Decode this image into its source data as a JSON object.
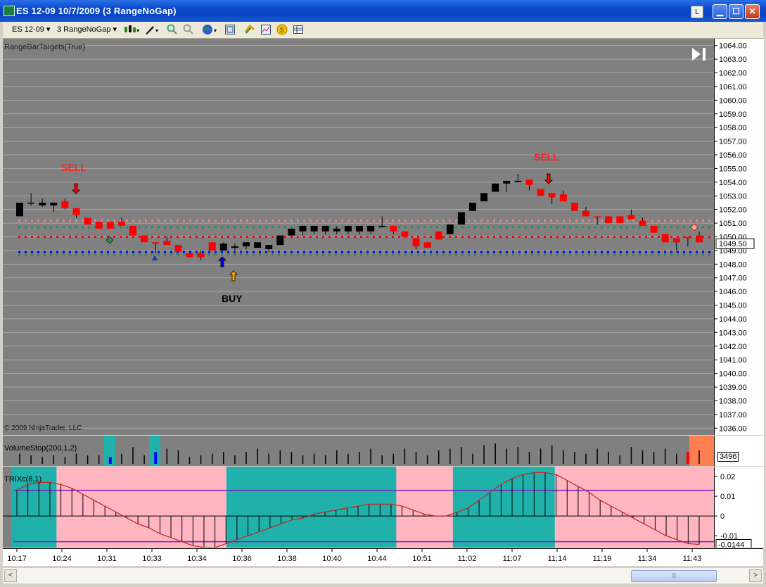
{
  "window": {
    "title": "ES 12-09  10/7/2009 (3 RangeNoGap)",
    "link_button": "L"
  },
  "toolbar": {
    "instrument": "ES 12-09",
    "period": "3 RangeNoGap"
  },
  "panels": {
    "price_label": "RangeBarTargets(True)",
    "copyright": "© 2009 NinjaTrader, LLC",
    "volume_label": "VolumeStop(200,1,2)",
    "trix_label": "TRIXc(8,1)"
  },
  "signals": {
    "sell_1": "SELL",
    "sell_2": "SELL",
    "buy_1": "BUY"
  },
  "axis": {
    "price_ticks": [
      "1064.00",
      "1063.00",
      "1062.00",
      "1061.00",
      "1060.00",
      "1059.00",
      "1058.00",
      "1057.00",
      "1056.00",
      "1055.00",
      "1054.00",
      "1053.00",
      "1052.00",
      "1051.00",
      "1050.00",
      "1049.00",
      "1048.00",
      "1047.00",
      "1046.00",
      "1045.00",
      "1044.00",
      "1043.00",
      "1042.00",
      "1041.00",
      "1040.00",
      "1039.00",
      "1038.00",
      "1037.00",
      "1036.00"
    ],
    "last_price": "1049.50",
    "volume_value": "3496",
    "trix_ticks": [
      "0.02",
      "0.01",
      "0",
      "-0.01"
    ],
    "trix_value": "-0.0144",
    "time_ticks": [
      "10:17",
      "10:24",
      "10:31",
      "10:33",
      "10:34",
      "10:36",
      "10:38",
      "10:40",
      "10:44",
      "10:51",
      "11:02",
      "11:07",
      "11:14",
      "11:19",
      "11:34",
      "11:43"
    ]
  },
  "scrollbar": {
    "left_arrow": "<",
    "right_arrow": ">",
    "thumb_grip": "|||"
  },
  "colors": {
    "panel_bg": "#808080",
    "up_bar": "#000000",
    "down_bar": "#ff0000",
    "trix_up_zone": "#20b2aa",
    "trix_down_zone": "#ffb6c1",
    "target_red": "#ff0000",
    "target_pink": "#ff8080",
    "target_green": "#2e8b57",
    "target_blue": "#0000ff"
  },
  "chart_data": {
    "type": "candlestick",
    "price_range": [
      1035.5,
      1064.5
    ],
    "candles": [
      {
        "o": 1051.5,
        "c": 1052.5,
        "h": 1052.5,
        "l": 1051.5,
        "dir": "up"
      },
      {
        "o": 1052.5,
        "c": 1052.5,
        "h": 1053.2,
        "l": 1052.3,
        "dir": "up"
      },
      {
        "o": 1052.5,
        "c": 1052.3,
        "h": 1052.8,
        "l": 1052.2,
        "dir": "up"
      },
      {
        "o": 1052.5,
        "c": 1052.3,
        "h": 1052.5,
        "l": 1051.8,
        "dir": "up"
      },
      {
        "o": 1052.6,
        "c": 1052.1,
        "h": 1052.8,
        "l": 1052.0,
        "dir": "down"
      },
      {
        "o": 1052.1,
        "c": 1051.6,
        "h": 1052.1,
        "l": 1051.4,
        "dir": "down"
      },
      {
        "o": 1051.4,
        "c": 1050.9,
        "h": 1051.4,
        "l": 1050.9,
        "dir": "down"
      },
      {
        "o": 1051.1,
        "c": 1050.6,
        "h": 1051.1,
        "l": 1050.6,
        "dir": "down"
      },
      {
        "o": 1051.1,
        "c": 1050.6,
        "h": 1051.1,
        "l": 1050.6,
        "dir": "down"
      },
      {
        "o": 1051.1,
        "c": 1050.8,
        "h": 1051.4,
        "l": 1050.8,
        "dir": "down"
      },
      {
        "o": 1050.8,
        "c": 1050.1,
        "h": 1050.8,
        "l": 1050.1,
        "dir": "down"
      },
      {
        "o": 1050.1,
        "c": 1049.6,
        "h": 1050.1,
        "l": 1049.6,
        "dir": "down"
      },
      {
        "o": 1049.6,
        "c": 1049.5,
        "h": 1049.6,
        "l": 1048.8,
        "dir": "down"
      },
      {
        "o": 1049.7,
        "c": 1049.4,
        "h": 1050.0,
        "l": 1049.4,
        "dir": "down"
      },
      {
        "o": 1049.4,
        "c": 1048.9,
        "h": 1049.4,
        "l": 1048.9,
        "dir": "down"
      },
      {
        "o": 1048.8,
        "c": 1048.5,
        "h": 1048.8,
        "l": 1048.5,
        "dir": "down"
      },
      {
        "o": 1048.8,
        "c": 1048.5,
        "h": 1049.0,
        "l": 1048.3,
        "dir": "down"
      },
      {
        "o": 1049.6,
        "c": 1049.0,
        "h": 1049.6,
        "l": 1049.0,
        "dir": "down"
      },
      {
        "o": 1049.0,
        "c": 1049.5,
        "h": 1049.6,
        "l": 1049.0,
        "dir": "up"
      },
      {
        "o": 1049.2,
        "c": 1049.3,
        "h": 1049.5,
        "l": 1049.0,
        "dir": "up"
      },
      {
        "o": 1049.3,
        "c": 1049.6,
        "h": 1049.6,
        "l": 1049.1,
        "dir": "up"
      },
      {
        "o": 1049.2,
        "c": 1049.6,
        "h": 1049.6,
        "l": 1049.2,
        "dir": "up"
      },
      {
        "o": 1049.1,
        "c": 1049.4,
        "h": 1049.4,
        "l": 1048.9,
        "dir": "up"
      },
      {
        "o": 1049.4,
        "c": 1050.1,
        "h": 1050.1,
        "l": 1049.4,
        "dir": "up"
      },
      {
        "o": 1050.1,
        "c": 1050.6,
        "h": 1050.6,
        "l": 1050.1,
        "dir": "up"
      },
      {
        "o": 1050.4,
        "c": 1050.8,
        "h": 1050.8,
        "l": 1050.1,
        "dir": "up"
      },
      {
        "o": 1050.4,
        "c": 1050.8,
        "h": 1050.8,
        "l": 1050.2,
        "dir": "up"
      },
      {
        "o": 1050.4,
        "c": 1050.8,
        "h": 1050.8,
        "l": 1050.2,
        "dir": "up"
      },
      {
        "o": 1050.4,
        "c": 1050.6,
        "h": 1050.8,
        "l": 1050.2,
        "dir": "up"
      },
      {
        "o": 1050.4,
        "c": 1050.8,
        "h": 1050.8,
        "l": 1050.2,
        "dir": "up"
      },
      {
        "o": 1050.4,
        "c": 1050.8,
        "h": 1050.8,
        "l": 1050.2,
        "dir": "up"
      },
      {
        "o": 1050.4,
        "c": 1050.8,
        "h": 1050.8,
        "l": 1050.2,
        "dir": "up"
      },
      {
        "o": 1050.8,
        "c": 1050.8,
        "h": 1051.5,
        "l": 1050.7,
        "dir": "up"
      },
      {
        "o": 1050.8,
        "c": 1050.4,
        "h": 1050.8,
        "l": 1050.2,
        "dir": "down"
      },
      {
        "o": 1050.4,
        "c": 1050.0,
        "h": 1050.4,
        "l": 1050.0,
        "dir": "down"
      },
      {
        "o": 1049.9,
        "c": 1049.3,
        "h": 1049.9,
        "l": 1049.1,
        "dir": "down"
      },
      {
        "o": 1049.6,
        "c": 1049.2,
        "h": 1049.6,
        "l": 1049.2,
        "dir": "down"
      },
      {
        "o": 1050.4,
        "c": 1049.8,
        "h": 1050.4,
        "l": 1049.8,
        "dir": "down"
      },
      {
        "o": 1050.2,
        "c": 1050.9,
        "h": 1050.9,
        "l": 1050.2,
        "dir": "up"
      },
      {
        "o": 1050.9,
        "c": 1051.8,
        "h": 1051.8,
        "l": 1050.9,
        "dir": "up"
      },
      {
        "o": 1051.9,
        "c": 1052.5,
        "h": 1052.5,
        "l": 1051.9,
        "dir": "up"
      },
      {
        "o": 1052.6,
        "c": 1053.2,
        "h": 1053.2,
        "l": 1052.6,
        "dir": "up"
      },
      {
        "o": 1053.3,
        "c": 1053.9,
        "h": 1053.9,
        "l": 1053.3,
        "dir": "up"
      },
      {
        "o": 1053.9,
        "c": 1054.1,
        "h": 1054.1,
        "l": 1053.3,
        "dir": "up"
      },
      {
        "o": 1054.0,
        "c": 1054.1,
        "h": 1054.6,
        "l": 1054.0,
        "dir": "up"
      },
      {
        "o": 1054.2,
        "c": 1053.8,
        "h": 1054.2,
        "l": 1053.4,
        "dir": "down"
      },
      {
        "o": 1053.5,
        "c": 1053.0,
        "h": 1053.5,
        "l": 1053.0,
        "dir": "down"
      },
      {
        "o": 1053.2,
        "c": 1052.9,
        "h": 1053.2,
        "l": 1052.4,
        "dir": "down"
      },
      {
        "o": 1053.1,
        "c": 1052.6,
        "h": 1053.4,
        "l": 1052.6,
        "dir": "down"
      },
      {
        "o": 1052.5,
        "c": 1051.9,
        "h": 1052.5,
        "l": 1051.9,
        "dir": "down"
      },
      {
        "o": 1051.9,
        "c": 1051.5,
        "h": 1052.2,
        "l": 1051.5,
        "dir": "down"
      },
      {
        "o": 1051.5,
        "c": 1051.5,
        "h": 1051.5,
        "l": 1050.9,
        "dir": "down"
      },
      {
        "o": 1051.5,
        "c": 1051.0,
        "h": 1051.5,
        "l": 1051.0,
        "dir": "down"
      },
      {
        "o": 1051.5,
        "c": 1051.0,
        "h": 1051.5,
        "l": 1051.0,
        "dir": "down"
      },
      {
        "o": 1051.6,
        "c": 1051.3,
        "h": 1052.0,
        "l": 1051.3,
        "dir": "down"
      },
      {
        "o": 1051.2,
        "c": 1050.8,
        "h": 1051.4,
        "l": 1050.8,
        "dir": "down"
      },
      {
        "o": 1050.8,
        "c": 1050.3,
        "h": 1050.8,
        "l": 1050.3,
        "dir": "down"
      },
      {
        "o": 1050.2,
        "c": 1049.6,
        "h": 1050.2,
        "l": 1049.6,
        "dir": "down"
      },
      {
        "o": 1049.9,
        "c": 1049.6,
        "h": 1049.9,
        "l": 1049.0,
        "dir": "down"
      },
      {
        "o": 1050.0,
        "c": 1049.9,
        "h": 1050.0,
        "l": 1049.3,
        "dir": "down"
      },
      {
        "o": 1050.1,
        "c": 1049.6,
        "h": 1050.4,
        "l": 1049.6,
        "dir": "down"
      }
    ],
    "target_lines": [
      {
        "price": 1051.2,
        "color": "pink"
      },
      {
        "price": 1050.7,
        "color": "green"
      },
      {
        "price": 1050.0,
        "color": "red"
      },
      {
        "price": 1048.9,
        "color": "blue"
      },
      {
        "price": 1048.7,
        "color": "green"
      }
    ],
    "volume": [
      6,
      5,
      4,
      5,
      4,
      6,
      5,
      5,
      4,
      6,
      10,
      5,
      7,
      9,
      8,
      4,
      5,
      6,
      7,
      5,
      7,
      9,
      6,
      8,
      7,
      5,
      6,
      5,
      8,
      6,
      7,
      9,
      5,
      6,
      9,
      7,
      5,
      8,
      9,
      10,
      6,
      11,
      12,
      9,
      10,
      7,
      9,
      11,
      8,
      7,
      6,
      9,
      7,
      5,
      10,
      8,
      7,
      9,
      6,
      7,
      8
    ],
    "trix": {
      "range": [
        -0.016,
        0.025
      ],
      "bands": [
        0.013,
        -0.013
      ],
      "values": [
        0.013,
        0.016,
        0.017,
        0.017,
        0.016,
        0.014,
        0.011,
        0.008,
        0.005,
        0.002,
        -0.001,
        -0.004,
        -0.006,
        -0.009,
        -0.011,
        -0.013,
        -0.015,
        -0.016,
        -0.016,
        -0.014,
        -0.012,
        -0.01,
        -0.008,
        -0.006,
        -0.004,
        -0.002,
        -0.001,
        0.001,
        0.002,
        0.003,
        0.004,
        0.005,
        0.006,
        0.006,
        0.006,
        0.005,
        0.003,
        0.001,
        0.0,
        0.0,
        0.002,
        0.004,
        0.008,
        0.012,
        0.016,
        0.019,
        0.021,
        0.022,
        0.022,
        0.021,
        0.018,
        0.015,
        0.012,
        0.008,
        0.005,
        0.002,
        -0.001,
        -0.004,
        -0.007,
        -0.01,
        -0.012,
        -0.014,
        -0.0144
      ],
      "zones": [
        "up",
        "up",
        "up",
        "up",
        "down",
        "down",
        "down",
        "down",
        "down",
        "down",
        "down",
        "down",
        "down",
        "down",
        "down",
        "down",
        "down",
        "down",
        "down",
        "up",
        "up",
        "up",
        "up",
        "up",
        "up",
        "up",
        "up",
        "up",
        "up",
        "up",
        "up",
        "up",
        "up",
        "up",
        "down",
        "down",
        "down",
        "down",
        "down",
        "up",
        "up",
        "up",
        "up",
        "up",
        "up",
        "up",
        "up",
        "up",
        "down",
        "down",
        "down",
        "down",
        "down",
        "down",
        "down",
        "down",
        "down",
        "down",
        "down",
        "down",
        "down",
        "down",
        "down"
      ]
    }
  }
}
